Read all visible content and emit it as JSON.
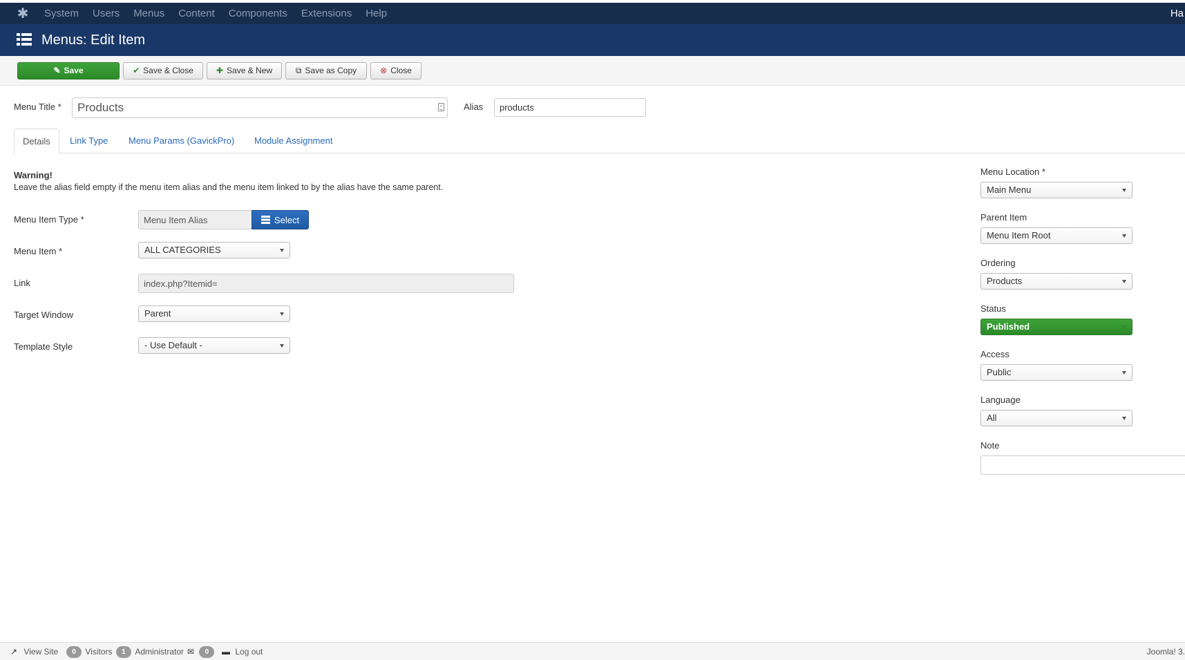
{
  "topbar": {
    "nav": [
      "System",
      "Users",
      "Menus",
      "Content",
      "Components",
      "Extensions",
      "Help"
    ],
    "user_label": "Ha"
  },
  "header": {
    "title": "Menus: Edit Item"
  },
  "toolbar": {
    "save": "Save",
    "save_close": "Save & Close",
    "save_new": "Save & New",
    "save_copy": "Save as Copy",
    "close": "Close"
  },
  "form": {
    "menu_title_label": "Menu Title *",
    "menu_title_value": "Products",
    "alias_label": "Alias",
    "alias_value": "products"
  },
  "tabs": [
    "Details",
    "Link Type",
    "Menu Params (GavickPro)",
    "Module Assignment"
  ],
  "details": {
    "warning_title": "Warning!",
    "warning_text": "Leave the alias field empty if the menu item alias and the menu item linked to by the alias have the same parent.",
    "menu_item_type_label": "Menu Item Type *",
    "menu_item_type_value": "Menu Item Alias",
    "select_button": "Select",
    "menu_item_label": "Menu Item *",
    "menu_item_value": "ALL CATEGORIES",
    "link_label": "Link",
    "link_value": "index.php?Itemid=",
    "target_window_label": "Target Window",
    "target_window_value": "Parent",
    "template_style_label": "Template Style",
    "template_style_value": "- Use Default -"
  },
  "sidebar": {
    "menu_location_label": "Menu Location *",
    "menu_location_value": "Main Menu",
    "parent_item_label": "Parent Item",
    "parent_item_value": "Menu Item Root",
    "ordering_label": "Ordering",
    "ordering_value": "Products",
    "status_label": "Status",
    "status_value": "Published",
    "access_label": "Access",
    "access_value": "Public",
    "language_label": "Language",
    "language_value": "All",
    "note_label": "Note",
    "note_value": ""
  },
  "statusbar": {
    "view_site": "View Site",
    "visitors_count": "0",
    "visitors_label": "Visitors",
    "admin_count": "1",
    "admin_label": "Administrator",
    "messages_count": "0",
    "logout": "Log out",
    "version": "Joomla! 3."
  },
  "colors": {
    "topbar_bg": "#172d4c",
    "titlebar_bg": "#1a3867",
    "save_green": "#2d8a2a",
    "select_blue": "#1f5aa3",
    "link_blue": "#2a69b8"
  }
}
